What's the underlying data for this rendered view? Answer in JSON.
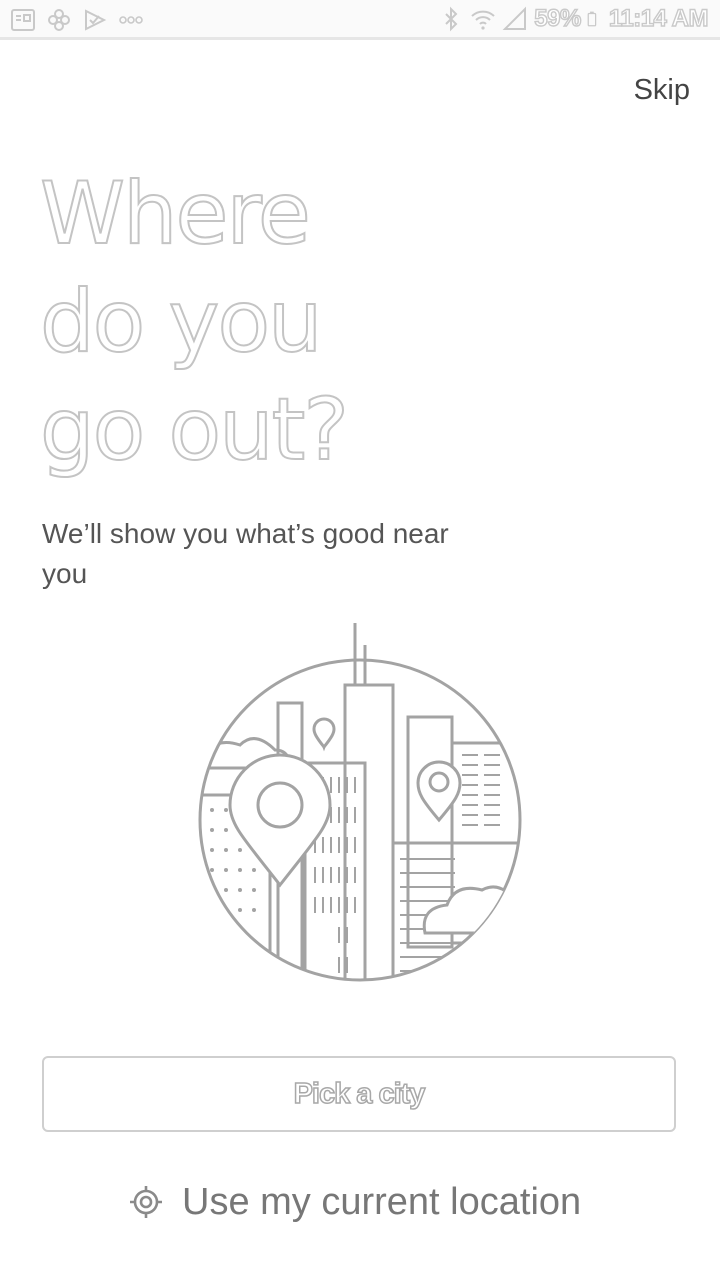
{
  "status_bar": {
    "battery_percent": "59%",
    "time": "11:14 AM",
    "left_icons": [
      "image-notification-icon",
      "pinwheel-notification-icon",
      "check-notification-icon",
      "more-dots-icon"
    ],
    "right_icons": [
      "bluetooth-icon",
      "wifi-icon",
      "signal-icon",
      "battery-icon"
    ]
  },
  "header": {
    "skip_label": "Skip"
  },
  "hero": {
    "headline_lines": [
      "Where",
      "do you",
      "go out?"
    ],
    "subtitle": "We’ll show you what’s good near you"
  },
  "illustration": {
    "icon": "city-skyline-with-map-pins-illustration"
  },
  "actions": {
    "pick_city_label": "Pick a city",
    "use_location_label": "Use my current location",
    "use_location_icon": "location-target-icon"
  },
  "colors": {
    "background": "#ffffff",
    "text": "#4a4a4a",
    "outline": "#c4c4c4",
    "button_border": "#cfcfcf"
  }
}
